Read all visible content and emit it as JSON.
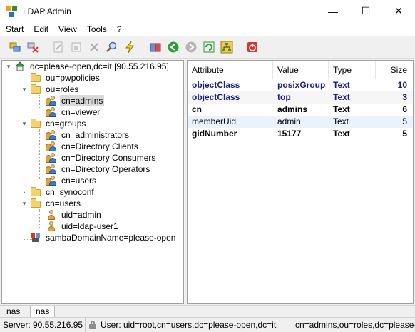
{
  "window": {
    "title": "LDAP Admin",
    "minimize": "—",
    "maximize": "☐",
    "close": "✕"
  },
  "menu": [
    "Start",
    "Edit",
    "View",
    "Tools",
    "?"
  ],
  "toolbar": {
    "icons": [
      "connect-icon",
      "disconnect-icon",
      "edit-icon",
      "properties-icon",
      "delete-icon",
      "search-icon",
      "flash-icon",
      "schema-book-icon",
      "back-icon",
      "forward-icon",
      "refresh-icon",
      "tree-icon",
      "exit-icon"
    ],
    "accent_green": "#2e9e3a",
    "accent_red": "#d9372b"
  },
  "tree": {
    "root": "dc=please-open,dc=it [90.55.216.95]",
    "nodes": [
      {
        "label": "ou=pwpolicies"
      },
      {
        "label": "ou=roles"
      },
      {
        "label": "cn=admins"
      },
      {
        "label": "cn=viewer"
      },
      {
        "label": "cn=groups"
      },
      {
        "label": "cn=administrators"
      },
      {
        "label": "cn=Directory Clients"
      },
      {
        "label": "cn=Directory Consumers"
      },
      {
        "label": "cn=Directory Operators"
      },
      {
        "label": "cn=users"
      },
      {
        "label": "cn=synoconf"
      },
      {
        "label": "cn=users"
      },
      {
        "label": "uid=admin"
      },
      {
        "label": "uid=ldap-user1"
      },
      {
        "label": "sambaDomainName=please-open"
      }
    ]
  },
  "grid": {
    "headers": [
      "Attribute",
      "Value",
      "Type",
      "Size"
    ],
    "rows": [
      {
        "attribute": "objectClass",
        "value": "posixGroup",
        "type": "Text",
        "size": "10"
      },
      {
        "attribute": "objectClass",
        "value": "top",
        "type": "Text",
        "size": "3"
      },
      {
        "attribute": "cn",
        "value": "admins",
        "type": "Text",
        "size": "6"
      },
      {
        "attribute": "memberUid",
        "value": "admin",
        "type": "Text",
        "size": "5"
      },
      {
        "attribute": "gidNumber",
        "value": "15177",
        "type": "Text",
        "size": "5"
      }
    ]
  },
  "tabs": [
    "nas",
    "nas"
  ],
  "status": {
    "server": "Server: 90.55.216.95",
    "user": "User: uid=root,cn=users,dc=please-open,dc=it",
    "dn": "cn=admins,ou=roles,dc=please-open,dc=it"
  }
}
